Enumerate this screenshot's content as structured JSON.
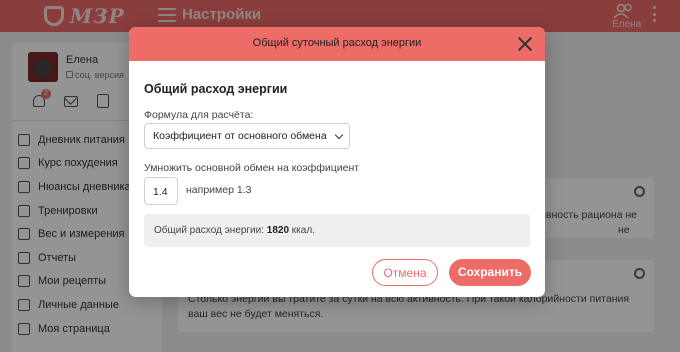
{
  "header": {
    "logo_text": "МЗР",
    "title": "Настройки",
    "user_label": "Елена"
  },
  "sidebar": {
    "profile_name": "Елена",
    "profile_sub": "соц. версия",
    "notifications_count": "2",
    "items": [
      {
        "label": "Дневник питания"
      },
      {
        "label": "Курс похудения"
      },
      {
        "label": "Нюансы дневника"
      },
      {
        "label": "Тренировки"
      },
      {
        "label": "Вес и измерения"
      },
      {
        "label": "Отчеты"
      },
      {
        "label": "Мои рецепты"
      },
      {
        "label": "Личные данные"
      },
      {
        "label": "Моя страница"
      }
    ]
  },
  "main": {
    "card1_text": "ивность рациона не",
    "card1_text2": "не",
    "card2_text": "Столько энергии вы тратите за сутки на всю активность. При такой калорийности питания ваш вес не будет меняться."
  },
  "dialog": {
    "title": "Общий суточный расход энергии",
    "section_title": "Общий расход энергии",
    "formula_label": "Формула для расчёта:",
    "formula_value": "Коэффициент от основного обмена",
    "multiplier_label": "Умножить основной обмен на коэффициент",
    "coefficient_value": "1.4",
    "hint": "например 1.3",
    "result_prefix": "Общий расход энергии: ",
    "result_value": "1820",
    "result_unit": " ккал.",
    "cancel_label": "Отмена",
    "save_label": "Сохранить"
  },
  "colors": {
    "accent": "#ee6c67",
    "overlay": "rgba(0,0,0,0.42)"
  }
}
